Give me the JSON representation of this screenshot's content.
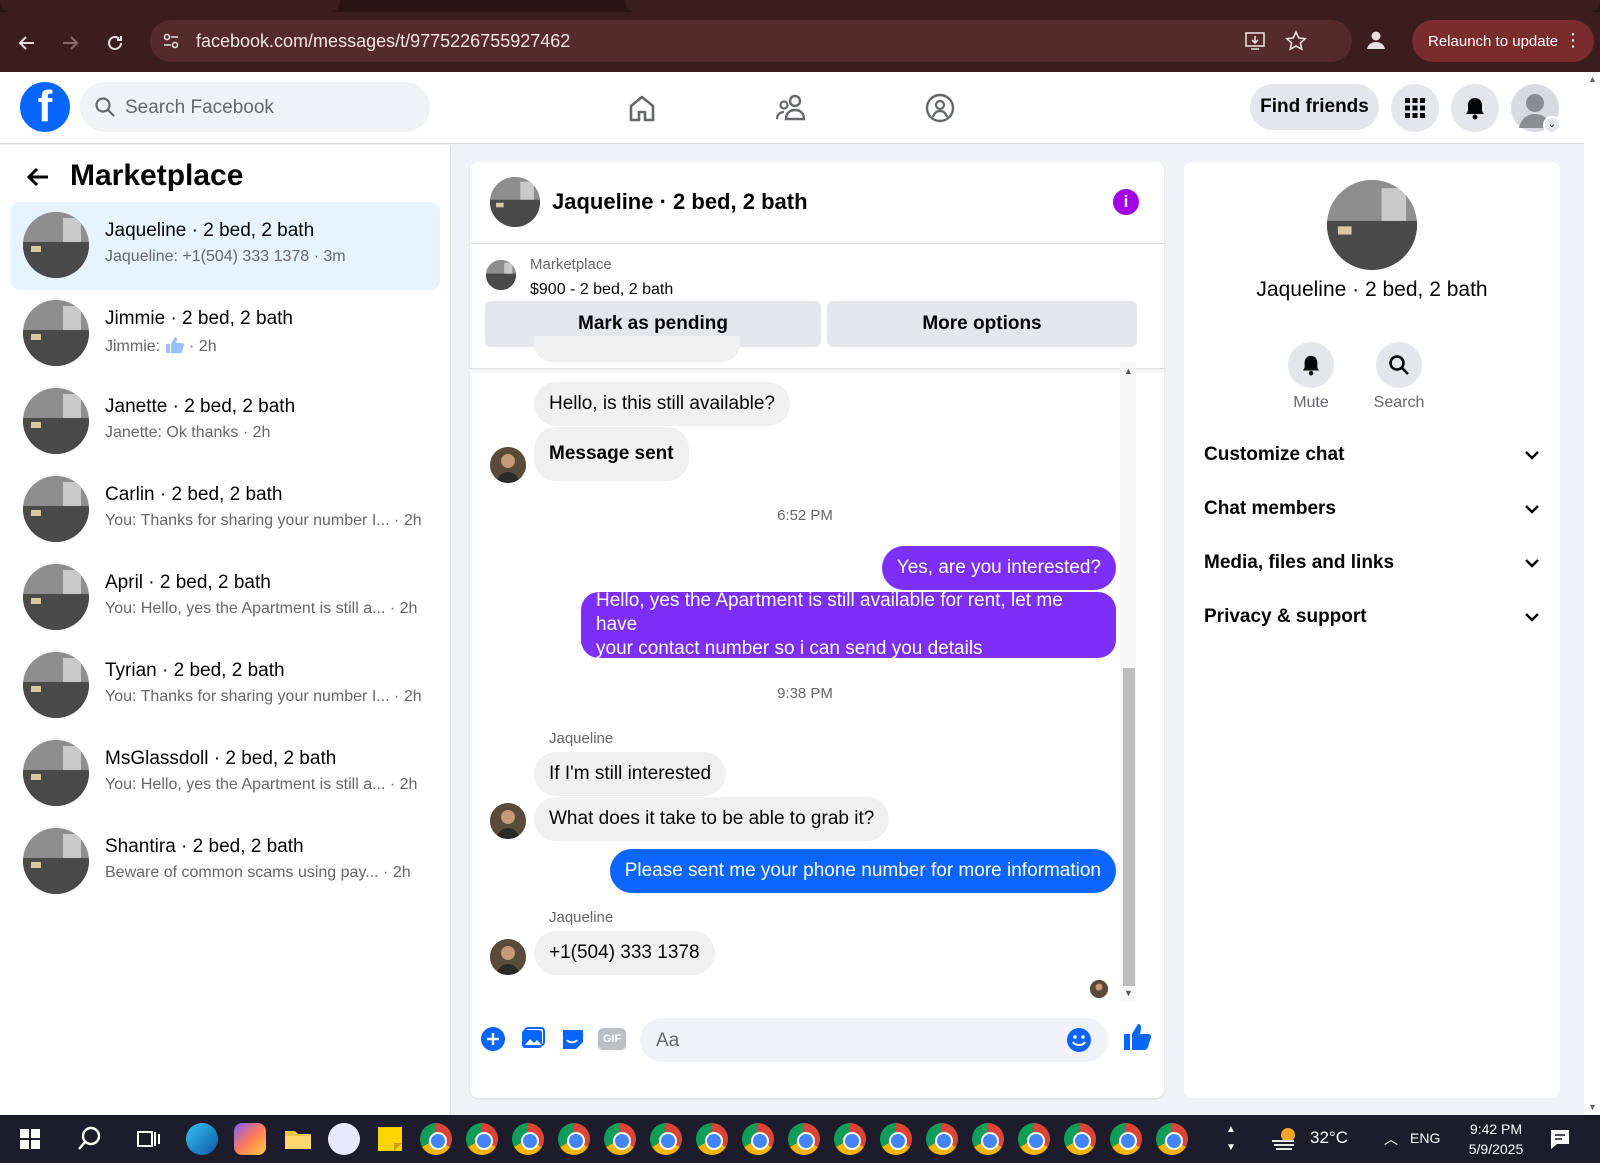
{
  "browser": {
    "url": "facebook.com/messages/t/9775226755927462",
    "relaunch_label": "Relaunch to update"
  },
  "fb_header": {
    "logo": "f",
    "search_placeholder": "Search Facebook",
    "find_friends_label": "Find friends"
  },
  "sidebar": {
    "title": "Marketplace",
    "conversations": [
      {
        "name": "Jaqueline · 2 bed, 2 bath",
        "preview": "Jaqueline: +1(504) 333 1378 · 3m",
        "time": ""
      },
      {
        "name": "Jimmie · 2 bed, 2 bath",
        "preview": "Jimmie: ",
        "time": " · 2h"
      },
      {
        "name": "Janette · 2 bed, 2 bath",
        "preview": "Janette: Ok thanks · 2h",
        "time": ""
      },
      {
        "name": "Carlin · 2 bed, 2 bath",
        "preview": "You: Thanks for sharing your number I...",
        "time": " · 2h"
      },
      {
        "name": "April · 2 bed, 2 bath",
        "preview": "You: Hello, yes the Apartment is still a...",
        "time": " · 2h"
      },
      {
        "name": "Tyrian · 2 bed, 2 bath",
        "preview": "You: Thanks for sharing your number I...",
        "time": " · 2h"
      },
      {
        "name": "MsGlassdoll · 2 bed, 2 bath",
        "preview": "You: Hello, yes the Apartment is still a...",
        "time": " · 2h"
      },
      {
        "name": "Shantira · 2 bed, 2 bath",
        "preview": "Beware of common scams using pay...",
        "time": " · 2h"
      }
    ]
  },
  "chat": {
    "title": "Jaqueline · 2 bed, 2 bath",
    "marketplace_label": "Marketplace",
    "listing": "$900 - 2 bed, 2 bath",
    "mark_pending_label": "Mark as pending",
    "more_options_label": "More options",
    "messages": {
      "m1": "Hello, is this still available?",
      "m2": "Message sent",
      "ts1": "6:52 PM",
      "m3": "Yes, are you interested?",
      "m4_line1": "Hello, yes the Apartment is still available for rent, let me have",
      "m4_line2": "your contact number so i can send you details",
      "ts2": "9:38 PM",
      "sender1": "Jaqueline",
      "m5": "If I'm still interested",
      "m6": "What does it take to be able to grab it?",
      "m7": "Please sent me your phone number for more information",
      "sender2": "Jaqueline",
      "m8": "+1(504) 333 1378"
    },
    "composer_placeholder": "Aa"
  },
  "right_panel": {
    "name": "Jaqueline · 2 bed, 2 bath",
    "mute_label": "Mute",
    "search_label": "Search",
    "sections": [
      "Customize chat",
      "Chat members",
      "Media, files and links",
      "Privacy & support"
    ]
  },
  "taskbar": {
    "temperature": "32°C",
    "language": "ENG",
    "time": "9:42 PM",
    "date": "5/9/2025"
  },
  "colors": {
    "fb_blue": "#0866ff",
    "messenger_purple": "#7b2ff7",
    "active_bg": "#e7f3ff",
    "chrome_bg": "#3c1d1d"
  }
}
